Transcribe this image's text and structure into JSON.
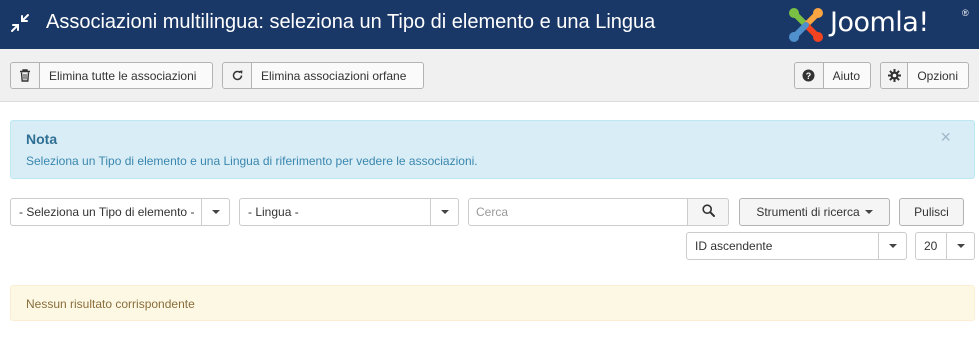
{
  "header": {
    "title": "Associazioni multilingua: seleziona un Tipo di elemento e una Lingua",
    "logo_text": "Joomla!",
    "logo_reg": "®",
    "background": "#1a3867"
  },
  "toolbar": {
    "delete_all_label": "Elimina tutte le associazioni",
    "delete_orphans_label": "Elimina associazioni orfane",
    "help_label": "Aiuto",
    "options_label": "Opzioni",
    "icons": [
      "trash-icon",
      "refresh-icon",
      "question-circle-icon",
      "gear-icon"
    ]
  },
  "alert": {
    "heading": "Nota",
    "message": "Seleziona un Tipo di elemento e una Lingua di riferimento per vedere le associazioni.",
    "close": "×"
  },
  "filters": {
    "item_type": "- Seleziona un Tipo di elemento -",
    "language": "- Lingua -",
    "search_placeholder": "Cerca",
    "search_value": "",
    "search_tools_label": "Strumenti di ricerca",
    "clear_label": "Pulisci",
    "ordering": "ID ascendente",
    "limit": "20"
  },
  "results": {
    "empty_message": "Nessun risultato corrispondente"
  }
}
